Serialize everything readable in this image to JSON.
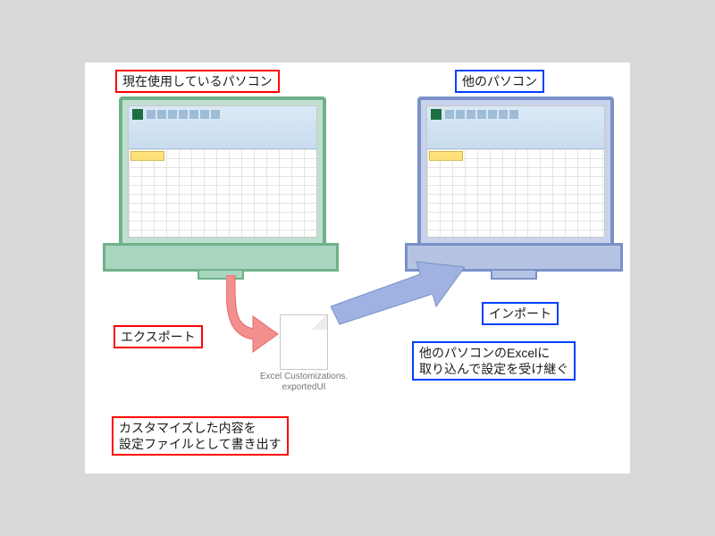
{
  "titles": {
    "current_pc": "現在使用しているパソコン",
    "other_pc": "他のパソコン"
  },
  "labels": {
    "export": "エクスポート",
    "import": "インポート",
    "export_note": "カスタマイズした内容を\n設定ファイルとして書き出す",
    "import_note": "他のパソコンのExcelに\n取り込んで設定を受け継ぐ"
  },
  "file": {
    "name": "Excel\nCustomizations.\nexportedUI"
  }
}
